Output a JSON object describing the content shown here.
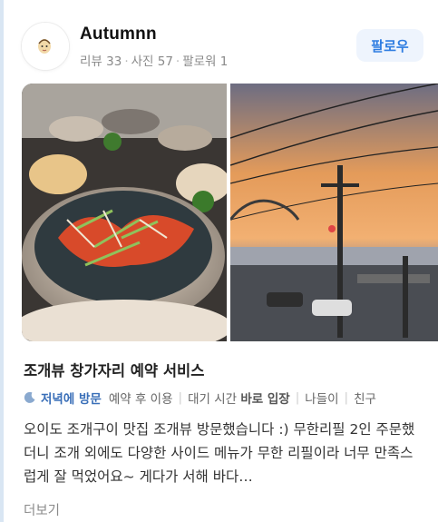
{
  "user": {
    "name": "Autumnn",
    "stats": [
      "리뷰 33",
      "사진 57",
      "팔로워 1"
    ]
  },
  "follow_label": "팔로우",
  "post": {
    "title": "조개뷰 창가자리 예약 서비스",
    "visit_label": "저녁에 방문",
    "tags": [
      {
        "text": "예약 후 이용"
      },
      {
        "text": "대기 시간 ",
        "bold": "바로 입장"
      },
      {
        "text": "나들이"
      },
      {
        "text": "친구"
      }
    ],
    "review": "오이도 조개구이 맛집 조개뷰 방문했습니다 :) 무한리필 2인 주문했더니 조개 외에도 다양한 사이드 메뉴가 무한 리필이라 너무 만족스럽게 잘 먹었어요~ 게다가 서해 바다…",
    "more_label": "더보기"
  },
  "photos": [
    {
      "icon": "seafood-photo"
    },
    {
      "icon": "sunset-photo"
    }
  ],
  "colors": {
    "accent": "#2f7de1",
    "follow_bg": "#eef4fd",
    "visit": "#3a6fb8"
  }
}
